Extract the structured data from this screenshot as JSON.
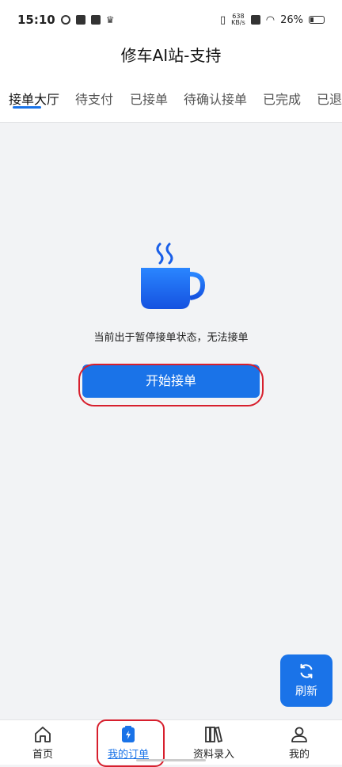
{
  "status_bar": {
    "time": "15:10",
    "net_speed_value": "638",
    "net_speed_unit": "KB/s",
    "battery": "26%"
  },
  "header": {
    "title": "修车AI站-支持"
  },
  "tabs": [
    {
      "label": "接单大厅",
      "active": true
    },
    {
      "label": "待支付",
      "active": false
    },
    {
      "label": "已接单",
      "active": false
    },
    {
      "label": "待确认接单",
      "active": false
    },
    {
      "label": "已完成",
      "active": false
    },
    {
      "label": "已退",
      "active": false
    }
  ],
  "main": {
    "empty_icon": "coffee-cup-icon",
    "message": "当前出于暂停接单状态，无法接单",
    "start_button_label": "开始接单"
  },
  "refresh_button": {
    "label": "刷新",
    "icon": "refresh-icon"
  },
  "bottom_nav": [
    {
      "label": "首页",
      "icon": "home-icon",
      "active": false
    },
    {
      "label": "我的订单",
      "icon": "order-icon",
      "active": true
    },
    {
      "label": "资料录入",
      "icon": "books-icon",
      "active": false
    },
    {
      "label": "我的",
      "icon": "user-icon",
      "active": false
    }
  ],
  "colors": {
    "accent": "#1a73e8",
    "highlight": "#d71f2d",
    "background": "#f2f3f5"
  }
}
